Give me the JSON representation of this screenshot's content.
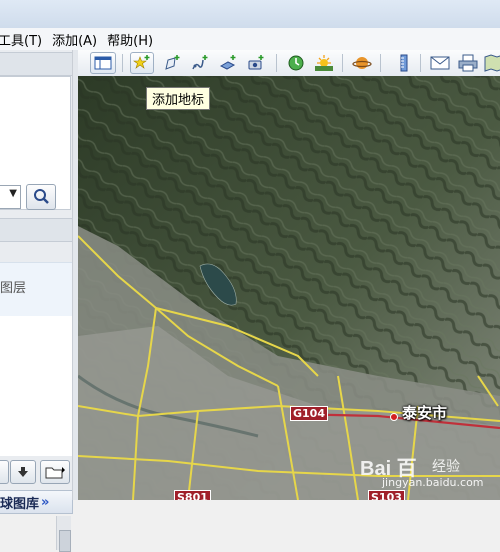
{
  "menu": {
    "tools": "工具(T)",
    "add": "添加(A)",
    "help": "帮助(H)"
  },
  "left_panel": {
    "layer_label": "图层",
    "gallery_label": "球图库",
    "gallery_arrow": "»"
  },
  "toolbar": {
    "tooltip": "添加地标"
  },
  "map": {
    "city_label": "泰安市",
    "road_g104": "G104",
    "road_s801": "S801",
    "road_s103": "S103"
  },
  "watermark": {
    "logo": "Bai 百",
    "product": "经验",
    "url": "jingyan.baidu.com"
  },
  "colors": {
    "road_yellow": "#e6d64a",
    "road_red": "#c0303a",
    "mountain_dark": "#3f4f37"
  }
}
